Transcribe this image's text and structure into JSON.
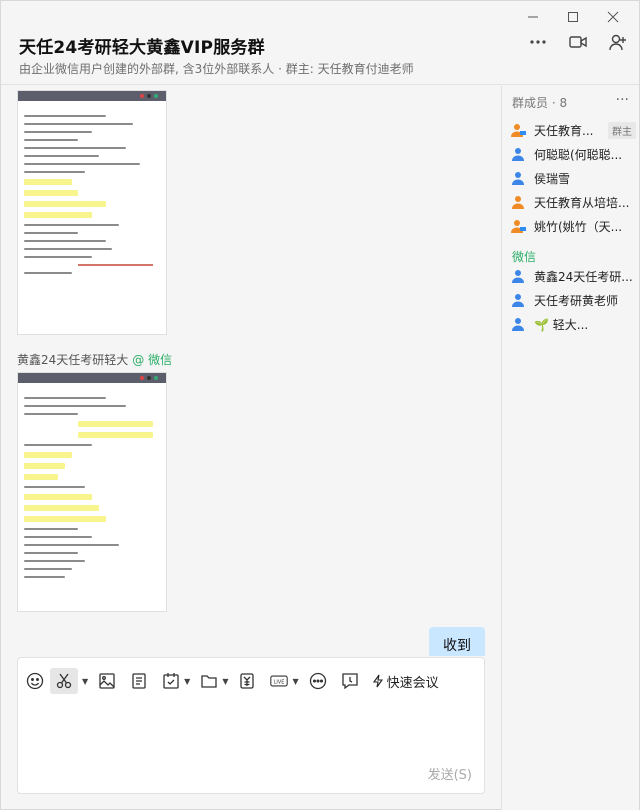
{
  "window": {
    "minimize": "—",
    "maximize": "□",
    "close": "✕"
  },
  "header": {
    "title": "天任24考研轻大黄鑫VIP服务群",
    "subtitle": "由企业微信用户创建的外部群, 含3位外部联系人 · 群主: 天任教育付迪老师",
    "icons": [
      "more-icon",
      "video-call-icon",
      "add-member-icon"
    ]
  },
  "chat": {
    "messages": [
      {
        "type": "image",
        "sender": "",
        "tag": ""
      },
      {
        "type": "image",
        "sender": "黄鑫24天任考研轻大",
        "tag": "@ 微信"
      },
      {
        "type": "text",
        "text": "收到",
        "from": "self"
      }
    ]
  },
  "panel": {
    "header": "群成员 · 8",
    "more": "···",
    "members": [
      {
        "name": "天任教育...",
        "badge": "群主",
        "avatar": "enterprise"
      },
      {
        "name": "何聪聪(何聪聪...",
        "avatar": "user"
      },
      {
        "name": "侯瑞雪",
        "avatar": "user"
      },
      {
        "name": "天任教育从培培...",
        "avatar": "user-orange"
      },
      {
        "name": "姚竹(姚竹（天...",
        "avatar": "enterprise"
      }
    ],
    "section_wechat": "微信",
    "wechat_members": [
      {
        "name": "黄鑫24天任考研...",
        "avatar": "user"
      },
      {
        "name": "天任考研黄老师",
        "avatar": "user"
      },
      {
        "name": "🌱 轻大...",
        "avatar": "user"
      }
    ]
  },
  "input": {
    "tools": [
      "emoji-icon",
      "screenshot-icon",
      "image-icon",
      "document-icon",
      "schedule-icon",
      "folder-icon",
      "red-packet-icon",
      "live-icon",
      "more-icon",
      "feedback-icon"
    ],
    "quick_meeting": "快速会议",
    "send_label": "发送(S)"
  }
}
